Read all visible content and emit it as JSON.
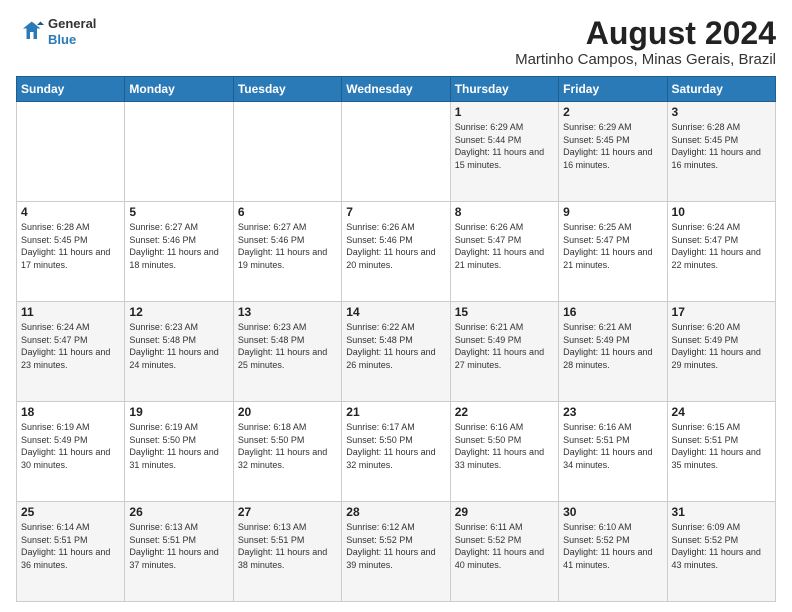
{
  "header": {
    "logo_line1": "General",
    "logo_line2": "Blue",
    "title": "August 2024",
    "subtitle": "Martinho Campos, Minas Gerais, Brazil"
  },
  "days_of_week": [
    "Sunday",
    "Monday",
    "Tuesday",
    "Wednesday",
    "Thursday",
    "Friday",
    "Saturday"
  ],
  "weeks": [
    {
      "row_class": "row-1",
      "days": [
        {
          "num": "",
          "info": ""
        },
        {
          "num": "",
          "info": ""
        },
        {
          "num": "",
          "info": ""
        },
        {
          "num": "",
          "info": ""
        },
        {
          "num": "1",
          "info": "Sunrise: 6:29 AM\nSunset: 5:44 PM\nDaylight: 11 hours and 15 minutes."
        },
        {
          "num": "2",
          "info": "Sunrise: 6:29 AM\nSunset: 5:45 PM\nDaylight: 11 hours and 16 minutes."
        },
        {
          "num": "3",
          "info": "Sunrise: 6:28 AM\nSunset: 5:45 PM\nDaylight: 11 hours and 16 minutes."
        }
      ]
    },
    {
      "row_class": "row-2",
      "days": [
        {
          "num": "4",
          "info": "Sunrise: 6:28 AM\nSunset: 5:45 PM\nDaylight: 11 hours and 17 minutes."
        },
        {
          "num": "5",
          "info": "Sunrise: 6:27 AM\nSunset: 5:46 PM\nDaylight: 11 hours and 18 minutes."
        },
        {
          "num": "6",
          "info": "Sunrise: 6:27 AM\nSunset: 5:46 PM\nDaylight: 11 hours and 19 minutes."
        },
        {
          "num": "7",
          "info": "Sunrise: 6:26 AM\nSunset: 5:46 PM\nDaylight: 11 hours and 20 minutes."
        },
        {
          "num": "8",
          "info": "Sunrise: 6:26 AM\nSunset: 5:47 PM\nDaylight: 11 hours and 21 minutes."
        },
        {
          "num": "9",
          "info": "Sunrise: 6:25 AM\nSunset: 5:47 PM\nDaylight: 11 hours and 21 minutes."
        },
        {
          "num": "10",
          "info": "Sunrise: 6:24 AM\nSunset: 5:47 PM\nDaylight: 11 hours and 22 minutes."
        }
      ]
    },
    {
      "row_class": "row-3",
      "days": [
        {
          "num": "11",
          "info": "Sunrise: 6:24 AM\nSunset: 5:47 PM\nDaylight: 11 hours and 23 minutes."
        },
        {
          "num": "12",
          "info": "Sunrise: 6:23 AM\nSunset: 5:48 PM\nDaylight: 11 hours and 24 minutes."
        },
        {
          "num": "13",
          "info": "Sunrise: 6:23 AM\nSunset: 5:48 PM\nDaylight: 11 hours and 25 minutes."
        },
        {
          "num": "14",
          "info": "Sunrise: 6:22 AM\nSunset: 5:48 PM\nDaylight: 11 hours and 26 minutes."
        },
        {
          "num": "15",
          "info": "Sunrise: 6:21 AM\nSunset: 5:49 PM\nDaylight: 11 hours and 27 minutes."
        },
        {
          "num": "16",
          "info": "Sunrise: 6:21 AM\nSunset: 5:49 PM\nDaylight: 11 hours and 28 minutes."
        },
        {
          "num": "17",
          "info": "Sunrise: 6:20 AM\nSunset: 5:49 PM\nDaylight: 11 hours and 29 minutes."
        }
      ]
    },
    {
      "row_class": "row-4",
      "days": [
        {
          "num": "18",
          "info": "Sunrise: 6:19 AM\nSunset: 5:49 PM\nDaylight: 11 hours and 30 minutes."
        },
        {
          "num": "19",
          "info": "Sunrise: 6:19 AM\nSunset: 5:50 PM\nDaylight: 11 hours and 31 minutes."
        },
        {
          "num": "20",
          "info": "Sunrise: 6:18 AM\nSunset: 5:50 PM\nDaylight: 11 hours and 32 minutes."
        },
        {
          "num": "21",
          "info": "Sunrise: 6:17 AM\nSunset: 5:50 PM\nDaylight: 11 hours and 32 minutes."
        },
        {
          "num": "22",
          "info": "Sunrise: 6:16 AM\nSunset: 5:50 PM\nDaylight: 11 hours and 33 minutes."
        },
        {
          "num": "23",
          "info": "Sunrise: 6:16 AM\nSunset: 5:51 PM\nDaylight: 11 hours and 34 minutes."
        },
        {
          "num": "24",
          "info": "Sunrise: 6:15 AM\nSunset: 5:51 PM\nDaylight: 11 hours and 35 minutes."
        }
      ]
    },
    {
      "row_class": "row-5",
      "days": [
        {
          "num": "25",
          "info": "Sunrise: 6:14 AM\nSunset: 5:51 PM\nDaylight: 11 hours and 36 minutes."
        },
        {
          "num": "26",
          "info": "Sunrise: 6:13 AM\nSunset: 5:51 PM\nDaylight: 11 hours and 37 minutes."
        },
        {
          "num": "27",
          "info": "Sunrise: 6:13 AM\nSunset: 5:51 PM\nDaylight: 11 hours and 38 minutes."
        },
        {
          "num": "28",
          "info": "Sunrise: 6:12 AM\nSunset: 5:52 PM\nDaylight: 11 hours and 39 minutes."
        },
        {
          "num": "29",
          "info": "Sunrise: 6:11 AM\nSunset: 5:52 PM\nDaylight: 11 hours and 40 minutes."
        },
        {
          "num": "30",
          "info": "Sunrise: 6:10 AM\nSunset: 5:52 PM\nDaylight: 11 hours and 41 minutes."
        },
        {
          "num": "31",
          "info": "Sunrise: 6:09 AM\nSunset: 5:52 PM\nDaylight: 11 hours and 43 minutes."
        }
      ]
    }
  ]
}
